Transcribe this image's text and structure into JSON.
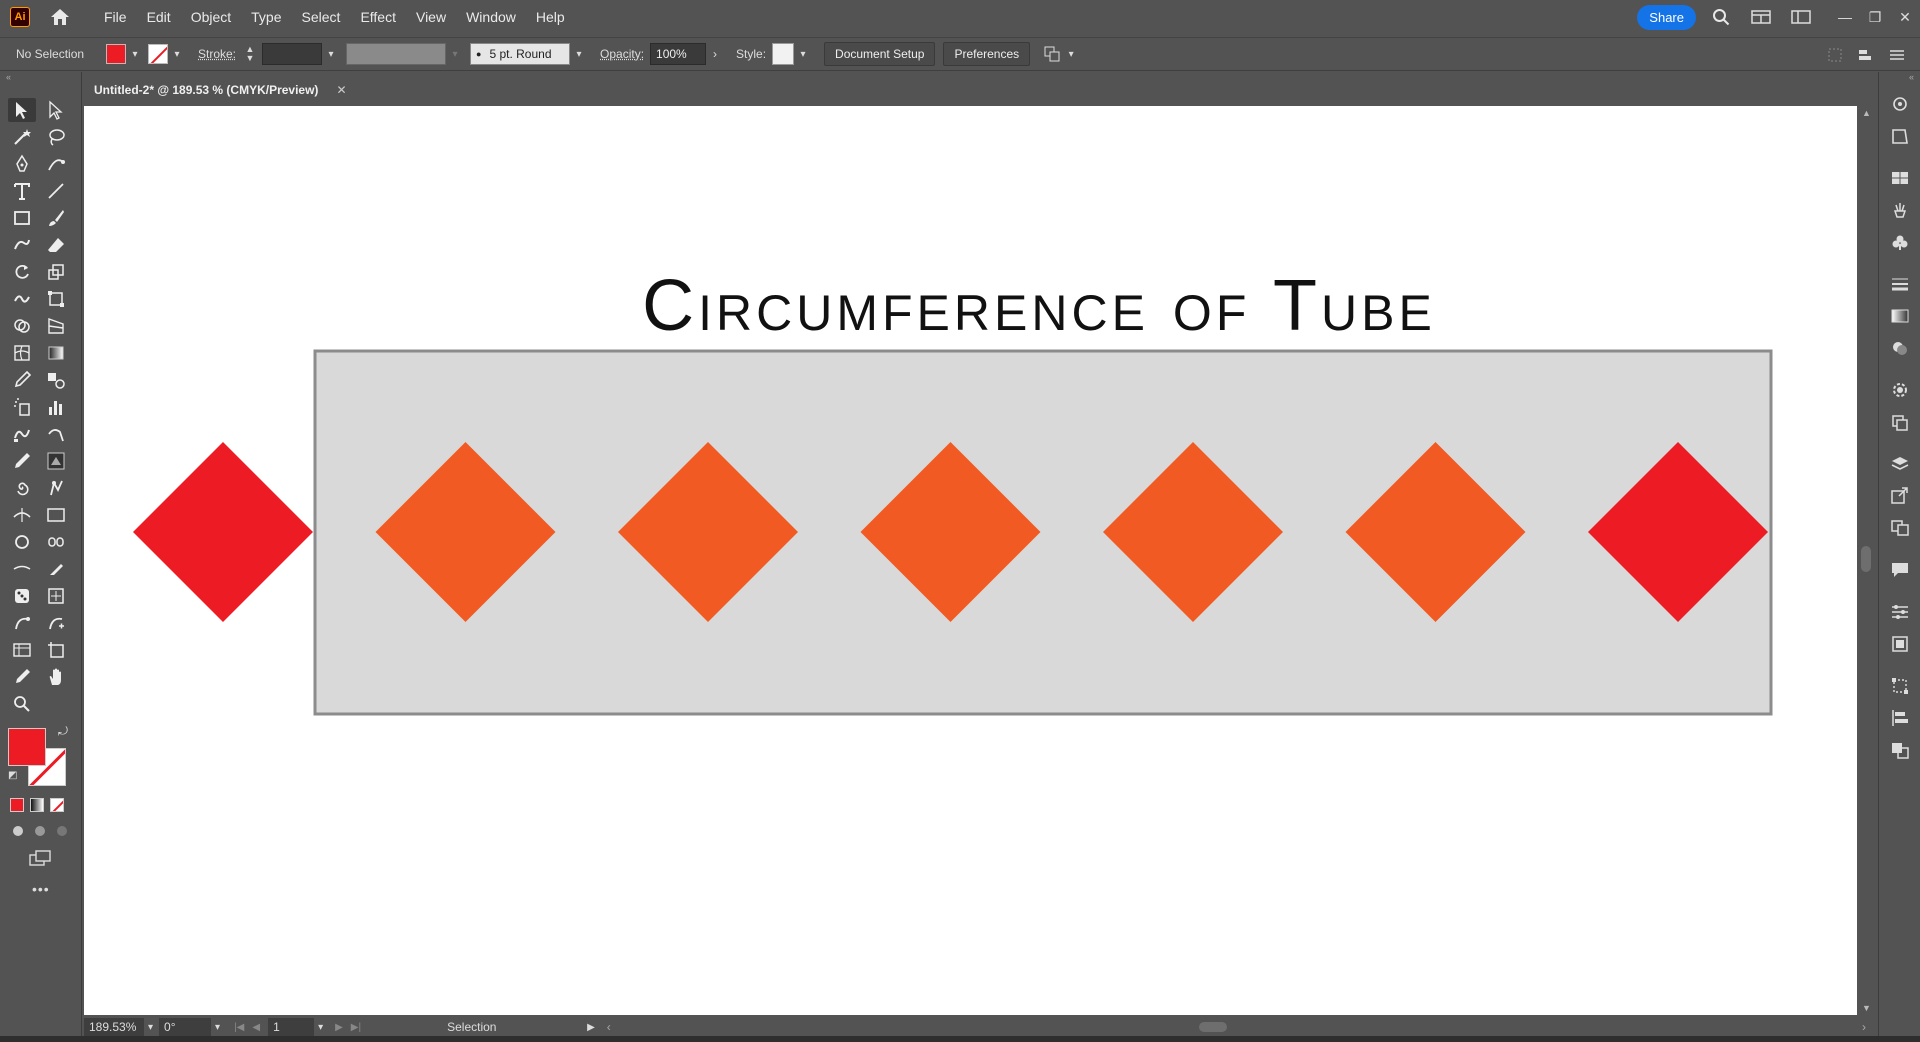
{
  "app": {
    "logo": "Ai"
  },
  "menu": [
    "File",
    "Edit",
    "Object",
    "Type",
    "Select",
    "Effect",
    "View",
    "Window",
    "Help"
  ],
  "topbar": {
    "share_label": "Share"
  },
  "control_bar": {
    "selection_state": "No Selection",
    "stroke_label": "Stroke:",
    "brush_label": "5 pt. Round",
    "opacity_label": "Opacity:",
    "opacity_value": "100%",
    "style_label": "Style:",
    "document_setup_label": "Document Setup",
    "preferences_label": "Preferences"
  },
  "document": {
    "tab_title": "Untitled-2* @ 189.53 % (CMYK/Preview)"
  },
  "artwork": {
    "title": "Circumference of Tube",
    "colors": {
      "red": "#ed1c24",
      "orange": "#f15a22",
      "panel_fill": "#d9d9d9",
      "panel_stroke": "#8c8c8c"
    },
    "diamonds": [
      {
        "color": "red"
      },
      {
        "color": "orange"
      },
      {
        "color": "orange"
      },
      {
        "color": "orange"
      },
      {
        "color": "orange"
      },
      {
        "color": "orange"
      },
      {
        "color": "red"
      }
    ]
  },
  "status_bar": {
    "zoom": "189.53%",
    "rotation": "0°",
    "artboard": "1",
    "current_tool": "Selection"
  },
  "colors": {
    "fill": "#ed1c24",
    "accent": "#1473e6"
  }
}
